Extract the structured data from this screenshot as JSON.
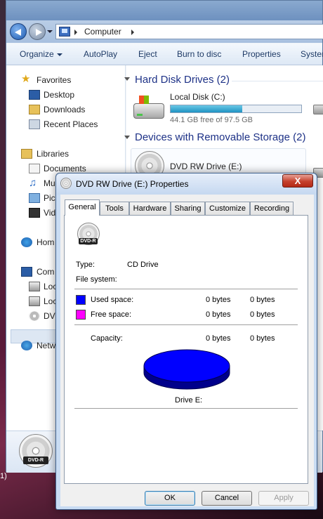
{
  "explorer": {
    "address": {
      "segment": "Computer"
    },
    "toolbar": {
      "organize": "Organize",
      "autoplay": "AutoPlay",
      "eject": "Eject",
      "burn": "Burn to disc",
      "properties": "Properties",
      "system": "Systen"
    },
    "nav": {
      "favorites": "Favorites",
      "desktop": "Desktop",
      "downloads": "Downloads",
      "recent": "Recent Places",
      "libraries": "Libraries",
      "documents": "Documents",
      "music": "Mu",
      "pictures": "Pic",
      "videos": "Vid",
      "homegroup": "Hom",
      "computer": "Com",
      "local1": "Loc",
      "local2": "Loc",
      "dvd": "DVI",
      "network": "Netw"
    },
    "content": {
      "hdd_group": "Hard Disk Drives (2)",
      "local_disk_name": "Local Disk (C:)",
      "local_disk_free": "44.1 GB free of 97.5 GB",
      "local_disk_used_fraction": 0.55,
      "removable_group": "Devices with Removable Storage (2)",
      "dvd_name": "DVD RW Drive (E:)"
    },
    "details": {
      "dvd_badge": "DVD-R"
    },
    "taskbar_text": "1)"
  },
  "dialog": {
    "title": "DVD RW Drive (E:) Properties",
    "close": "X",
    "tabs": [
      "General",
      "Tools",
      "Hardware",
      "Sharing",
      "Customize",
      "Recording"
    ],
    "icon_badge": "DVD-R",
    "type_label": "Type:",
    "type_value": "CD Drive",
    "fs_label": "File system:",
    "used_label": "Used space:",
    "used_bytes": "0 bytes",
    "used_bytes2": "0 bytes",
    "free_label": "Free space:",
    "free_bytes": "0 bytes",
    "free_bytes2": "0 bytes",
    "capacity_label": "Capacity:",
    "capacity_bytes": "0 bytes",
    "capacity_bytes2": "0 bytes",
    "drive_label": "Drive E:",
    "ok": "OK",
    "cancel": "Cancel",
    "apply": "Apply",
    "colors": {
      "used": "#0000ff",
      "free": "#ff00ff"
    }
  }
}
